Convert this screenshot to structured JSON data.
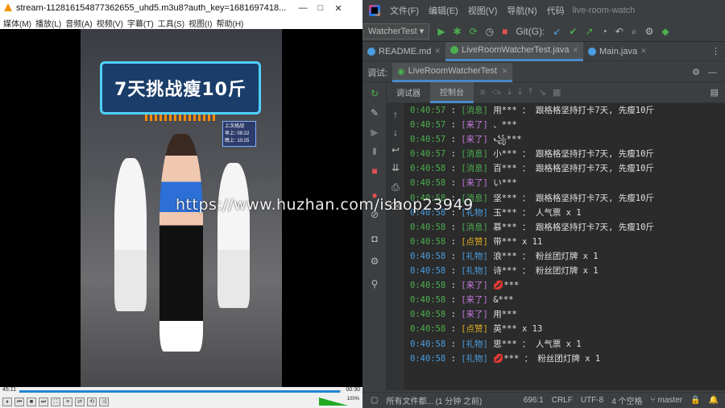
{
  "vlc": {
    "title": "stream-112816154877362655_uhd5.m3u8?auth_key=1681697418...",
    "window_buttons": [
      "—",
      "□",
      "✕"
    ],
    "menu": [
      "媒体(M)",
      "播放(L)",
      "音频(A)",
      "视频(V)",
      "字幕(T)",
      "工具(S)",
      "视图(I)",
      "帮助(H)"
    ],
    "video": {
      "banner_text": "7天挑战瘦10斤",
      "tag_lines": [
        "上次挑战",
        "早上: 09:22",
        "晚上: 10:25"
      ]
    },
    "time_elapsed": "45:11",
    "time_total": "00:30",
    "seek_progress": 0.996,
    "volume_label": "100%",
    "controls": [
      "⏸",
      "⏮",
      "■",
      "⏭",
      "⛶",
      "≡",
      "⇄",
      "⟲",
      "⤨"
    ]
  },
  "idea": {
    "menu": [
      "文件(F)",
      "编辑(E)",
      "视图(V)",
      "导航(N)",
      "代码"
    ],
    "window_title": "live-room-watch",
    "run_config": "WatcherTest",
    "toolbar_git": "Git(G):",
    "file_tabs": [
      {
        "label": "README.md",
        "active": false,
        "color": "#4a9de0"
      },
      {
        "label": "LiveRoomWatcherTest.java",
        "active": true,
        "color": "#4caf50"
      },
      {
        "label": "Main.java",
        "active": false,
        "color": "#4a9de0"
      }
    ],
    "debug_label": "调试:",
    "debug_tab": "LiveRoomWatcherTest",
    "sub_tabs": [
      "调试器",
      "控制台"
    ],
    "console_lines": [
      {
        "time": "0:40:57",
        "tag": "[消息]",
        "kind": "msg",
        "text": "用*** ： 跟格格坚持打卡7天, 先瘦10斤"
      },
      {
        "time": "0:40:57",
        "tag": "[来了]",
        "kind": "come",
        "text": "、***"
      },
      {
        "time": "0:40:57",
        "tag": "[来了]",
        "kind": "come",
        "text": "꧁***"
      },
      {
        "time": "0:40:57",
        "tag": "[消息]",
        "kind": "msg",
        "text": "小*** ： 跟格格坚持打卡7天, 先瘦10斤"
      },
      {
        "time": "0:40:58",
        "tag": "[消息]",
        "kind": "msg",
        "text": "百*** ： 跟格格坚持打卡7天, 先瘦10斤"
      },
      {
        "time": "0:40:58",
        "tag": "[来了]",
        "kind": "come",
        "text": "い***"
      },
      {
        "time": "0:40:58",
        "tag": "[消息]",
        "kind": "msg",
        "text": "坚*** ： 跟格格坚持打卡7天, 先瘦10斤"
      },
      {
        "time": "0:40:58",
        "tag": "[礼物]",
        "kind": "gift",
        "text": "玉*** ： 人气票 x 1"
      },
      {
        "time": "0:40:58",
        "tag": "[消息]",
        "kind": "msg",
        "text": "慕*** ： 跟格格坚持打卡7天, 先瘦10斤"
      },
      {
        "time": "0:40:58",
        "tag": "[点赞]",
        "kind": "like",
        "text": "带*** x 11"
      },
      {
        "time": "0:40:58",
        "tag": "[礼物]",
        "kind": "gift",
        "text": "浪*** ： 粉丝团灯牌 x 1"
      },
      {
        "time": "0:40:58",
        "tag": "[礼物]",
        "kind": "gift",
        "text": "诗*** ： 粉丝团灯牌 x 1"
      },
      {
        "time": "0:40:58",
        "tag": "[来了]",
        "kind": "come",
        "text": "💋***"
      },
      {
        "time": "0:40:58",
        "tag": "[来了]",
        "kind": "come",
        "text": "&***"
      },
      {
        "time": "0:40:58",
        "tag": "[来了]",
        "kind": "come",
        "text": "用***"
      },
      {
        "time": "0:40:58",
        "tag": "[点赞]",
        "kind": "like",
        "text": "英*** x 13"
      },
      {
        "time": "0:40:58",
        "tag": "[礼物]",
        "kind": "gift",
        "text": "思*** ： 人气票 x 1"
      },
      {
        "time": "0:40:58",
        "tag": "[礼物]",
        "kind": "gift",
        "text": "💋*** ： 粉丝团灯牌 x 1"
      }
    ],
    "status": {
      "message": "所有文件都... (1 分钟 之前)",
      "position": "696:1",
      "line_ending": "CRLF",
      "encoding": "UTF-8",
      "indent": "4 个空格",
      "branch": "master"
    }
  },
  "watermark": "https://www.huzhan.com/ishop23949"
}
